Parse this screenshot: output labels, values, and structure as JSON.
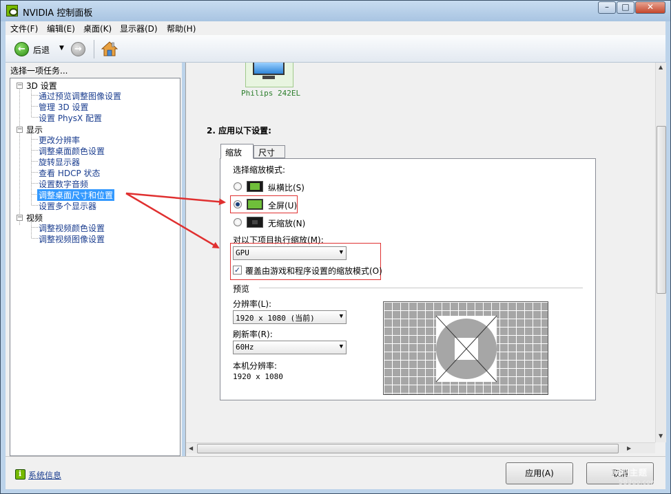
{
  "window": {
    "title": "NVIDIA 控制面板"
  },
  "menu": [
    "文件(F)",
    "编辑(E)",
    "桌面(K)",
    "显示器(D)",
    "帮助(H)"
  ],
  "toolbar": {
    "back_label": "后退"
  },
  "left": {
    "header": "选择一项任务...",
    "categories": [
      {
        "label": "3D 设置",
        "items": [
          "通过预览调整图像设置",
          "管理 3D 设置",
          "设置 PhysX 配置"
        ]
      },
      {
        "label": "显示",
        "items": [
          "更改分辨率",
          "调整桌面颜色设置",
          "旋转显示器",
          "查看 HDCP 状态",
          "设置数字音频",
          "调整桌面尺寸和位置",
          "设置多个显示器"
        ]
      },
      {
        "label": "视频",
        "items": [
          "调整视频颜色设置",
          "调整视频图像设置"
        ]
      }
    ],
    "selected_item": "调整桌面尺寸和位置"
  },
  "content": {
    "monitor_name": "Philips 242EL",
    "section_title": "2. 应用以下设置:",
    "tabs": [
      "缩放",
      "尺寸"
    ],
    "active_tab": "缩放",
    "scaling_mode_label": "选择缩放模式:",
    "modes": [
      "纵横比(S)",
      "全屏(U)",
      "无缩放(N)"
    ],
    "selected_mode": "全屏(U)",
    "perform_on_label": "对以下项目执行缩放(M):",
    "perform_on_value": "GPU",
    "override_label": "覆盖由游戏和程序设置的缩放模式(O)",
    "override_checked": true,
    "preview_label": "预览",
    "resolution_label": "分辨率(L):",
    "resolution_value": "1920 x 1080 (当前)",
    "refresh_label": "刷新率(R):",
    "refresh_value": "60Hz",
    "native_label": "本机分辨率:",
    "native_value": "1920 x 1080"
  },
  "bottom": {
    "system_info": "系统信息",
    "apply": "应用(A)",
    "cancel": "取消"
  },
  "watermark": {
    "main": "网吧主题",
    "sub": "583go.com"
  },
  "colors": {
    "accent": "#76b900",
    "highlight": "#3399ff",
    "annotation_red": "#e03030"
  }
}
